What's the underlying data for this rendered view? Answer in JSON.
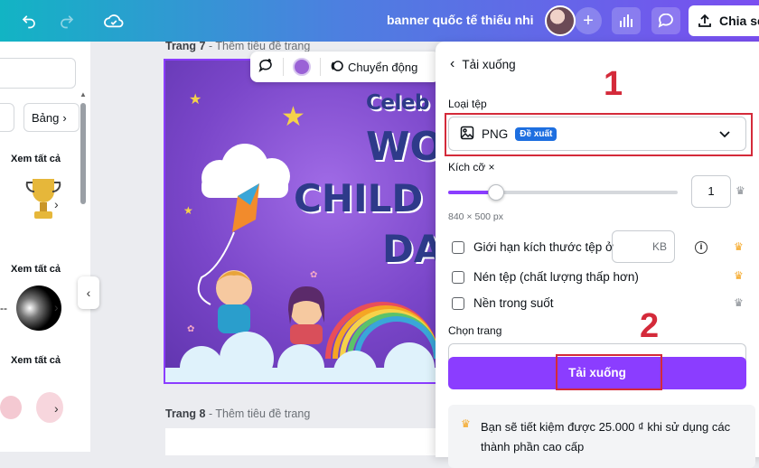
{
  "topbar": {
    "title": "banner quốc tế thiếu nhi",
    "share_label": "Chia sẻ",
    "plus_label": "+"
  },
  "left_panel": {
    "chips": [
      "",
      "Bảng"
    ],
    "see_all_1": "Xem tất cả",
    "see_all_2": "Xem tất cả",
    "see_all_3": "Xem tất cả",
    "arrow": "›",
    "dash": "--",
    "collapse": "‹"
  },
  "canvas": {
    "page7_label": "Trang 7",
    "page7_sub": " - Thêm tiêu đề trang",
    "page8_label": "Trang 8",
    "page8_sub": " - Thêm tiêu đề trang",
    "banner_line1": "Celeb",
    "banner_line2": "WO",
    "banner_line3": "CHILD",
    "banner_line4": "DA",
    "toolbar_animate": "Chuyển động"
  },
  "download_panel": {
    "back_title": "Tải xuống",
    "file_type_label": "Loại tệp",
    "file_type_value": "PNG",
    "recommended_badge": "Đề xuất",
    "size_label": "Kích cỡ ×",
    "size_value": "1",
    "size_slider_fraction": 0.21,
    "dimensions": "840 × 500 px",
    "limit_size_label": "Giới hạn kích thước tệp ở",
    "kb_unit": "KB",
    "compress_label": "Nén tệp (chất lượng thấp hơn)",
    "transparent_label": "Nền trong suốt",
    "choose_page_label": "Chọn trang",
    "download_button": "Tải xuống",
    "promo_text": "Bạn sẽ tiết kiệm được 25.000 ₫ khi sử dụng các thành phần cao cấp"
  },
  "annotations": {
    "marker_1": "1",
    "marker_2": "2",
    "color": "#d42a3a"
  },
  "colors": {
    "accent": "#8b3dff",
    "badge": "#1e6fe0",
    "crown": "#f5a623"
  }
}
